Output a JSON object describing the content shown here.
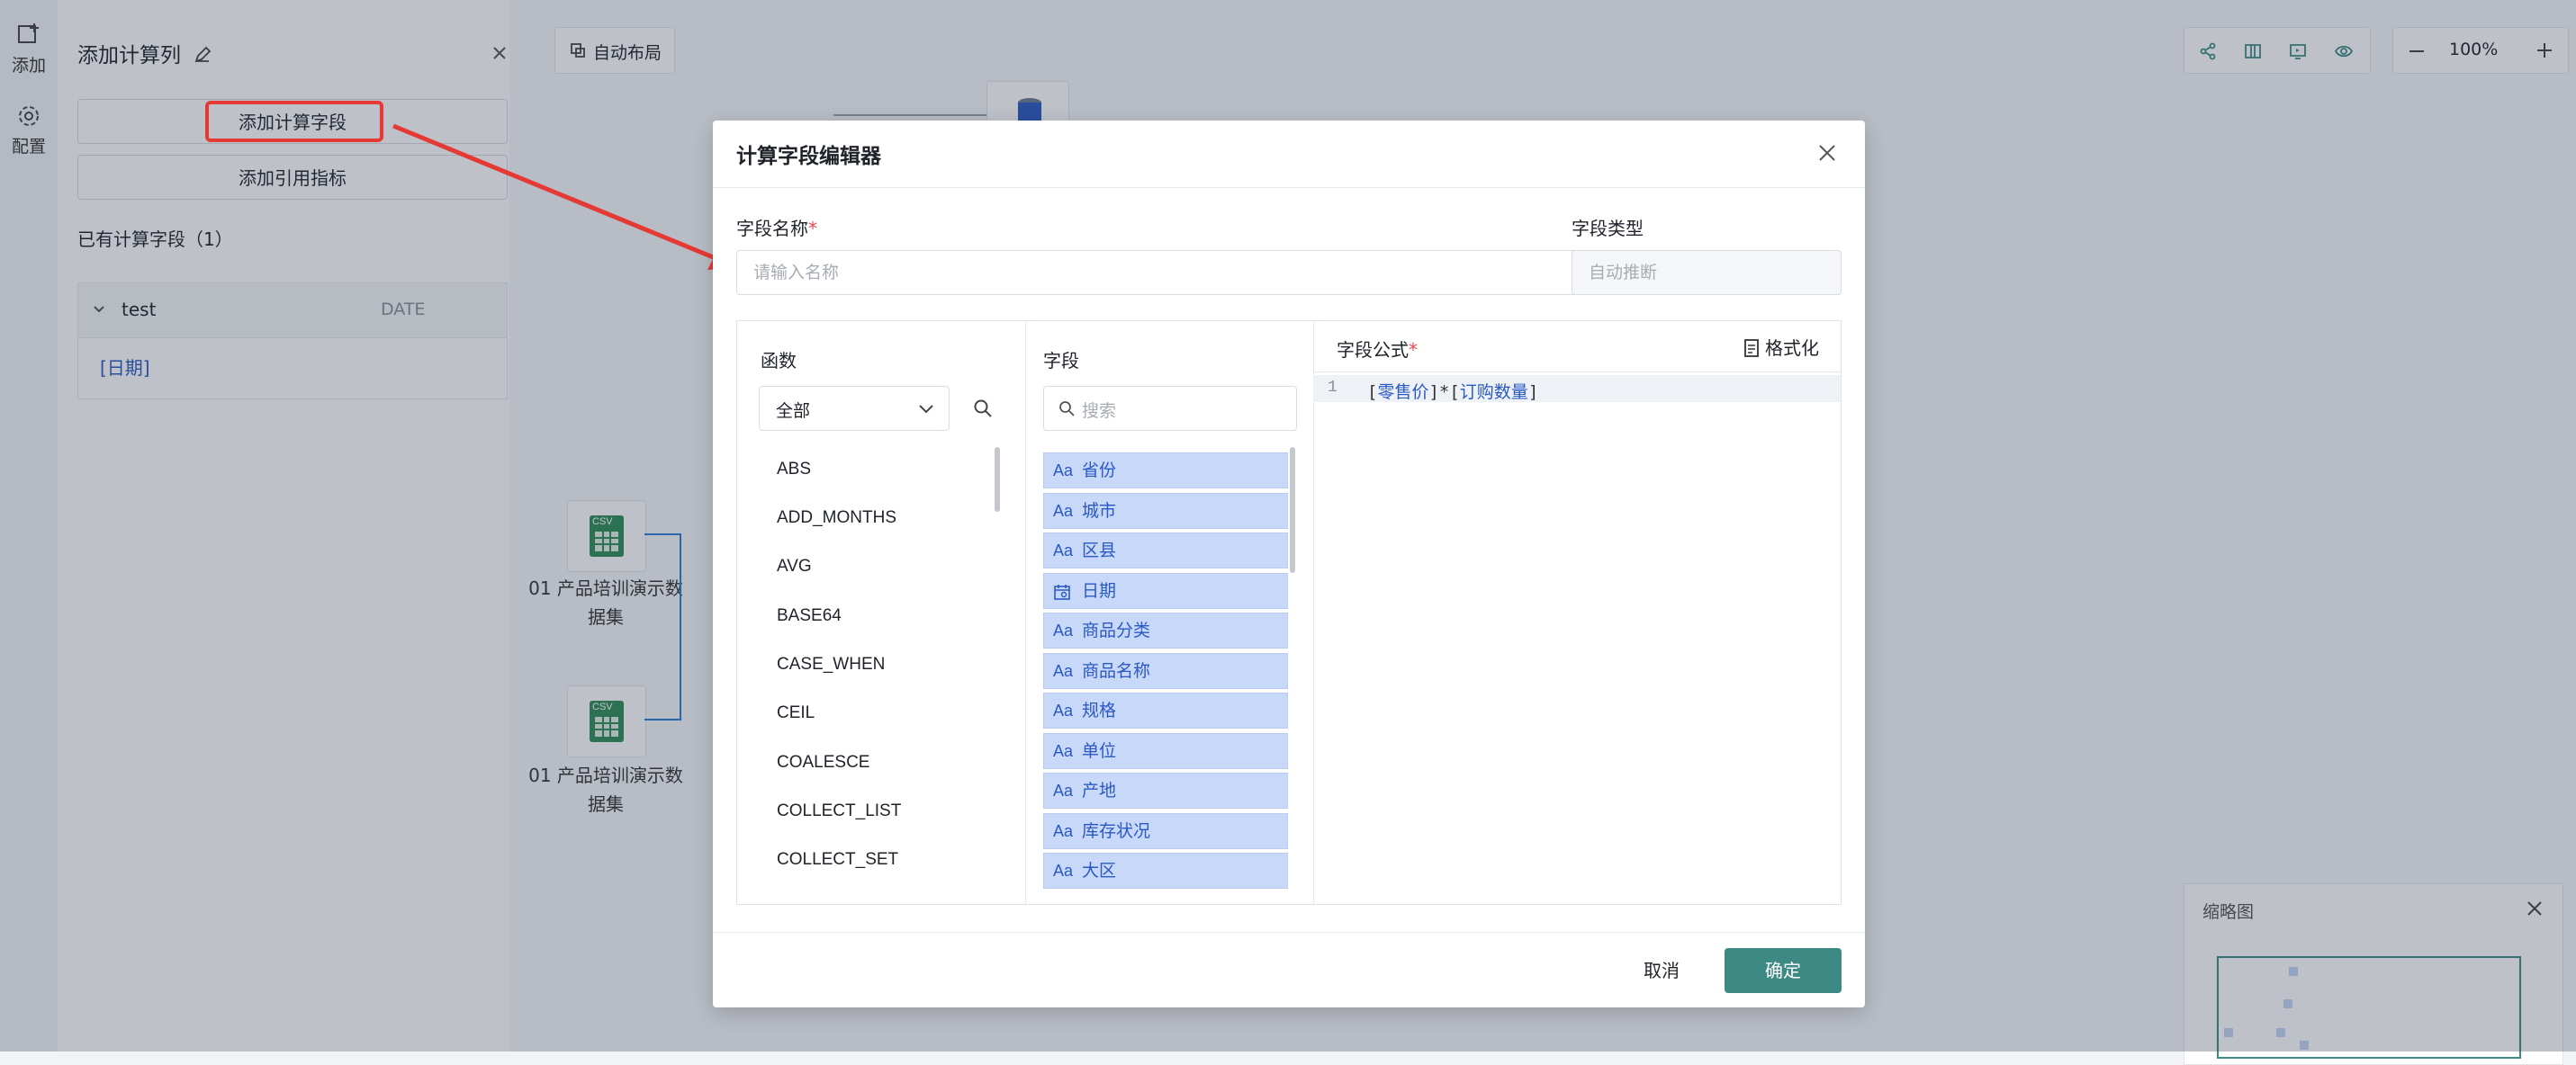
{
  "left_toolbar": {
    "add_label": "添加",
    "config_label": "配置"
  },
  "side_panel": {
    "title": "添加计算列",
    "add_calc_field_label": "添加计算字段",
    "add_ref_metric_label": "添加引用指标",
    "existing_label": "已有计算字段（1）",
    "table": {
      "name": "test",
      "type": "DATE",
      "rows": [
        "[日期]"
      ]
    }
  },
  "canvas": {
    "auto_layout_label": "自动布局",
    "zoom": "100%",
    "nodes": [
      {
        "icon_text": "CSV",
        "label": "01 产品培训演示数据集"
      },
      {
        "icon_text": "CSV",
        "label": "01 产品培训演示数据集"
      }
    ],
    "minimap_title": "缩略图"
  },
  "modal": {
    "title": "计算字段编辑器",
    "field_name_label": "字段名称",
    "field_name_placeholder": "请输入名称",
    "field_type_label": "字段类型",
    "field_type_placeholder": "自动推断",
    "functions": {
      "title": "函数",
      "category_selected": "全部",
      "items": [
        "ABS",
        "ADD_MONTHS",
        "AVG",
        "BASE64",
        "CASE_WHEN",
        "CEIL",
        "COALESCE",
        "COLLECT_LIST",
        "COLLECT_SET"
      ]
    },
    "fields": {
      "title": "字段",
      "search_placeholder": "搜索",
      "items": [
        {
          "type_icon": "Aa",
          "label": "省份"
        },
        {
          "type_icon": "Aa",
          "label": "城市"
        },
        {
          "type_icon": "Aa",
          "label": "区县"
        },
        {
          "type_icon": "calendar-icon",
          "label": "日期"
        },
        {
          "type_icon": "Aa",
          "label": "商品分类"
        },
        {
          "type_icon": "Aa",
          "label": "商品名称"
        },
        {
          "type_icon": "Aa",
          "label": "规格"
        },
        {
          "type_icon": "Aa",
          "label": "单位"
        },
        {
          "type_icon": "Aa",
          "label": "产地"
        },
        {
          "type_icon": "Aa",
          "label": "库存状况"
        },
        {
          "type_icon": "Aa",
          "label": "大区"
        }
      ]
    },
    "formula": {
      "title": "字段公式",
      "format_label": "格式化",
      "line_number": "1",
      "parts": [
        "[",
        "零售价",
        "]*[",
        "订购数量",
        "]"
      ]
    },
    "cancel_label": "取消",
    "confirm_label": "确定"
  },
  "colors": {
    "primary": "#3d8a84",
    "field_chip": "#c8d8f8",
    "link": "#2b59c3",
    "annotation": "#e53935"
  }
}
